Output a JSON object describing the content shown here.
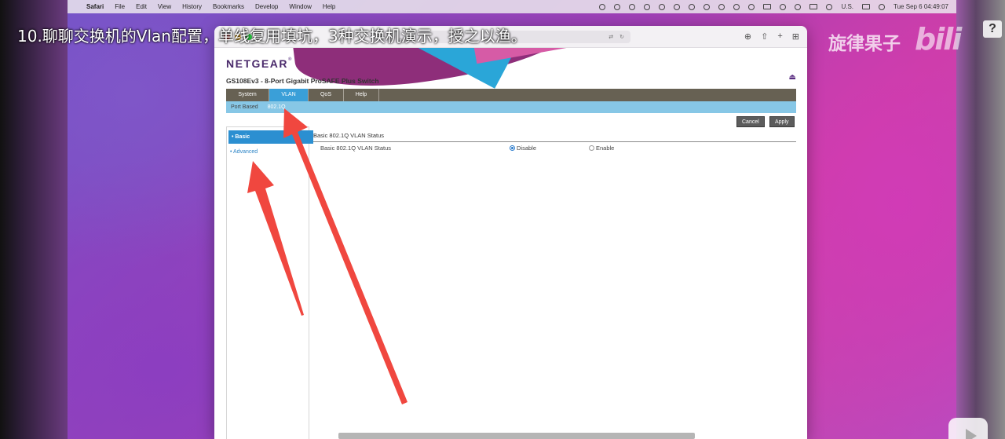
{
  "subtitle": "10.聊聊交换机的Vlan配置，单线复用填坑，3种交换机演示，授之以渔。",
  "watermark": {
    "channel": "旋律果子",
    "platform": "bili",
    "help": "?"
  },
  "menubar": {
    "apple": "",
    "items": [
      "Safari",
      "File",
      "Edit",
      "View",
      "History",
      "Bookmarks",
      "Develop",
      "Window",
      "Help"
    ],
    "input_source": "U.S.",
    "clock": "Tue Sep 6  04:49:07"
  },
  "browser": {
    "url": "",
    "traffic_colors": [
      "#ff5f57",
      "#febc2e",
      "#28c840"
    ]
  },
  "switch": {
    "brand": "NETGEAR",
    "brand_mark": "®",
    "model": "GS108Ev3 - 8-Port Gigabit ProSAFE Plus Switch",
    "tabs": [
      {
        "label": "System"
      },
      {
        "label": "VLAN"
      },
      {
        "label": "QoS"
      },
      {
        "label": "Help"
      }
    ],
    "active_tab": "VLAN",
    "subnav": [
      {
        "label": "Port Based"
      },
      {
        "label": "802.1Q"
      }
    ],
    "active_subnav": "802.1Q",
    "buttons": {
      "cancel": "Cancel",
      "apply": "Apply"
    },
    "sidebar": [
      {
        "label": "Basic"
      },
      {
        "label": "Advanced"
      }
    ],
    "active_sidebar": "Basic",
    "section_title": "Basic 802.1Q VLAN Status",
    "status_label": "Basic 802.1Q VLAN Status",
    "options": [
      {
        "label": "Disable",
        "selected": true
      },
      {
        "label": "Enable",
        "selected": false
      }
    ],
    "colors": {
      "nav": "#676153",
      "active": "#3a9fd8",
      "subnav": "#87c7e6",
      "link": "#2a83c6"
    }
  },
  "annotation_color": "#f0473f"
}
